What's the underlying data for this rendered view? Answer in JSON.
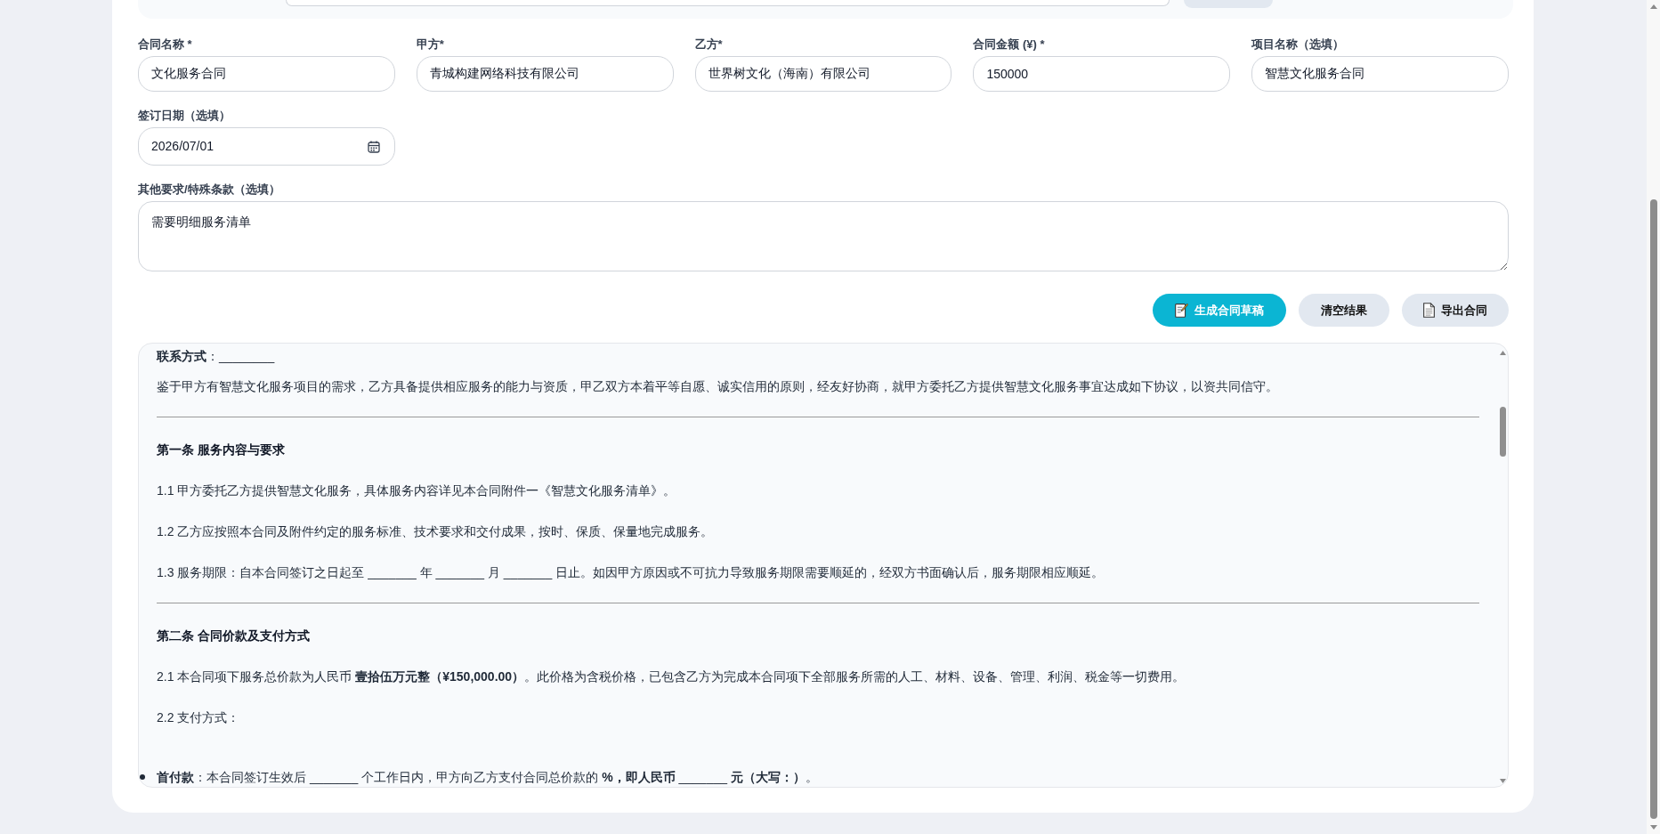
{
  "form": {
    "fields": [
      {
        "kind": "text",
        "label": "合同名称 *",
        "value": "文化服务合同"
      },
      {
        "kind": "text",
        "label": "甲方*",
        "value": "青城构建网络科技有限公司"
      },
      {
        "kind": "text",
        "label": "乙方*",
        "value": "世界树文化（海南）有限公司"
      },
      {
        "kind": "text",
        "label": "合同金额 (¥) *",
        "value": "150000"
      },
      {
        "kind": "text",
        "label": "项目名称（选填）",
        "value": "智慧文化服务合同"
      },
      {
        "kind": "date",
        "label": "签订日期（选填）",
        "value": "2026/07/01"
      }
    ],
    "notes": {
      "label": "其他要求/特殊条款（选填）",
      "value": "需要明细服务清单"
    }
  },
  "actions": [
    {
      "kind": "primary",
      "label": "生成合同草稿"
    },
    {
      "kind": "plain",
      "label": "清空结果"
    },
    {
      "kind": "document",
      "label": "导出合同"
    }
  ],
  "preview": {
    "blocks": [
      {
        "kind": "text",
        "text": "**联系方式**：________"
      },
      {
        "kind": "text",
        "text": "鉴于甲方有智慧文化服务项目的需求，乙方具备提供相应服务的能力与资质，甲乙双方本着平等自愿、诚实信用的原则，经友好协商，就甲方委托乙方提供智慧文化服务事宜达成如下协议，以资共同信守。"
      },
      {
        "kind": "divider"
      },
      {
        "kind": "heading",
        "text": "第一条 服务内容与要求"
      },
      {
        "kind": "text",
        "text": "1.1 甲方委托乙方提供智慧文化服务，具体服务内容详见本合同附件一《智慧文化服务清单》。"
      },
      {
        "kind": "text",
        "text": "1.2 乙方应按照本合同及附件约定的服务标准、技术要求和交付成果，按时、保质、保量地完成服务。"
      },
      {
        "kind": "text",
        "text": "1.3 服务期限：自本合同签订之日起至 _______ 年 _______ 月 _______ 日止。如因甲方原因或不可抗力导致服务期限需要顺延的，经双方书面确认后，服务期限相应顺延。"
      },
      {
        "kind": "divider"
      },
      {
        "kind": "heading",
        "text": "第二条 合同价款及支付方式"
      },
      {
        "kind": "text",
        "text": "2.1 本合同项下服务总价款为人民币 **壹拾伍万元整（¥150,000.00）**。此价格为含税价格，已包含乙方为完成本合同项下全部服务所需的人工、材料、设备、管理、利润、税金等一切费用。"
      },
      {
        "kind": "text",
        "text": "2.2 支付方式："
      },
      {
        "kind": "bullet",
        "text": "**首付款**：本合同签订生效后 _______ 个工作日内，甲方向乙方支付合同总价款的 **%，即人民币** _______ **元（大写：）**。"
      }
    ]
  }
}
